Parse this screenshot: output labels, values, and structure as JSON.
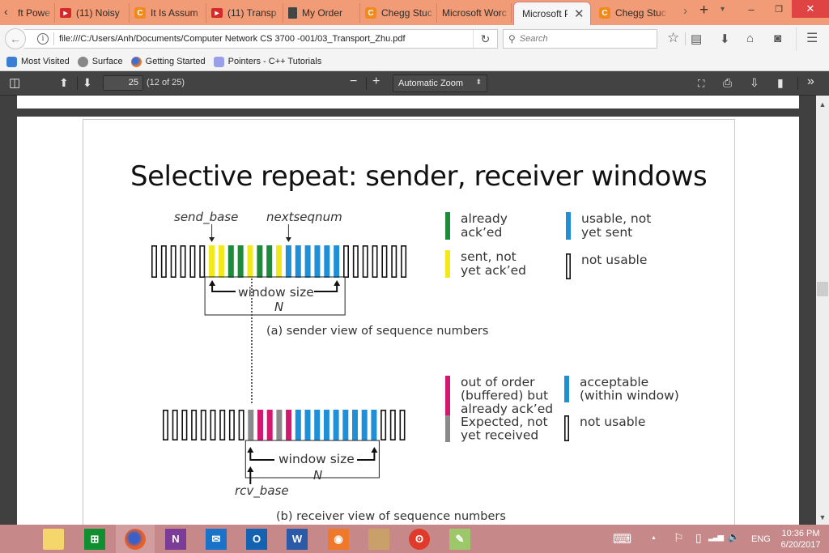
{
  "browser": {
    "tabs": [
      {
        "label": "ft Powe",
        "icon": "none"
      },
      {
        "label": "(11) Noisy",
        "icon": "youtube-icon"
      },
      {
        "label": "It Is Assum",
        "icon": "chegg-icon"
      },
      {
        "label": "(11) Transp",
        "icon": "youtube-icon"
      },
      {
        "label": "My Order",
        "icon": "document-icon"
      },
      {
        "label": "Chegg Stuc",
        "icon": "chegg-icon"
      },
      {
        "label": "Microsoft Worc",
        "icon": "none"
      },
      {
        "label": "Microsoft P",
        "icon": "none",
        "active": true
      },
      {
        "label": "Chegg Stuc",
        "icon": "chegg-icon"
      }
    ],
    "tab_scroll_left": "‹",
    "tab_scroll_right": "›",
    "new_tab": "+",
    "tab_list": "▾",
    "window_controls": {
      "minimize": "–",
      "restore": "❐",
      "close": "✕"
    },
    "back": "←",
    "url": "file:///C:/Users/Anh/Documents/Computer Network CS  3700 -001/03_Transport_Zhu.pdf",
    "reload": "↻",
    "search_placeholder": "Search",
    "toolbar_icons": [
      "bookmark-star-icon",
      "reading-list-icon",
      "download-icon",
      "home-icon",
      "pocket-icon",
      "menu-icon"
    ],
    "bookmarks": [
      {
        "label": "Most Visited",
        "color": "#3b7fd4"
      },
      {
        "label": "Surface",
        "color": "#777777"
      },
      {
        "label": "Getting Started",
        "color": "#e8792a"
      },
      {
        "label": "Pointers - C++ Tutorials",
        "color": "#7a7fd8"
      }
    ]
  },
  "pdf_viewer": {
    "page_number": "25",
    "page_count": "(12 of 25)",
    "zoom_minus": "−",
    "zoom_plus": "+",
    "zoom_value": "Automatic Zoom",
    "zoom_arrow": "⬍"
  },
  "slide": {
    "title": "Selective repeat: sender, receiver windows",
    "sender": {
      "base_label": "send_base",
      "next_label": "nextseqnum",
      "sequence": [
        "n",
        "n",
        "n",
        "n",
        "n",
        "n",
        "y",
        "y",
        "g",
        "g",
        "y",
        "g",
        "g",
        "y",
        "b",
        "b",
        "b",
        "b",
        "b",
        "b",
        "n",
        "n",
        "n",
        "n",
        "n",
        "n",
        "n"
      ],
      "window_label": "window size",
      "window_n": "N",
      "caption": "(a) sender view of sequence numbers",
      "legend": [
        {
          "key": "g",
          "text": [
            "already",
            "ack’ed"
          ]
        },
        {
          "key": "b",
          "text": [
            "usable, not",
            "yet sent"
          ]
        },
        {
          "key": "y",
          "text": [
            "sent, not",
            "yet ack’ed"
          ]
        },
        {
          "key": "n",
          "text": [
            "not usable"
          ]
        }
      ]
    },
    "receiver": {
      "base_label": "rcv_base",
      "sequence": [
        "n",
        "n",
        "n",
        "n",
        "n",
        "n",
        "n",
        "n",
        "n",
        "x",
        "p",
        "p",
        "x",
        "p",
        "b",
        "b",
        "b",
        "b",
        "b",
        "b",
        "b",
        "b",
        "b",
        "n",
        "n",
        "n"
      ],
      "window_label": "window size",
      "window_n": "N",
      "caption": "(b) receiver view of sequence numbers",
      "legend": [
        {
          "key": "p",
          "text": [
            "out of order",
            "(buffered) but",
            "already ack’ed"
          ]
        },
        {
          "key": "b",
          "text": [
            "acceptable",
            "(within window)"
          ]
        },
        {
          "key": "x",
          "text": [
            "Expected,  not",
            "yet received"
          ]
        },
        {
          "key": "n",
          "text": [
            "not usable"
          ]
        }
      ]
    },
    "colors": {
      "g": "#1e8a3c",
      "y": "#f2e81a",
      "b": "#1f8fd8",
      "p": "#d4176f",
      "x": "#8a8a8a",
      "n": "#ffffff"
    }
  },
  "taskbar": {
    "apps": [
      "windows-start-icon",
      "file-explorer-icon",
      "store-icon",
      "firefox-icon",
      "onenote-icon",
      "mail-icon",
      "outlook-icon",
      "word-icon",
      "camera-app-icon",
      "photo-app-icon",
      "owl-app-icon",
      "notepad-app-icon"
    ],
    "tray": {
      "keyboard": "⌨",
      "chevron": "▲",
      "flag": "⚐",
      "battery": "▯",
      "signal": "▂▃▅",
      "volume": "🔈",
      "language": "ENG"
    },
    "time": "10:36 PM",
    "date": "6/20/2017"
  }
}
